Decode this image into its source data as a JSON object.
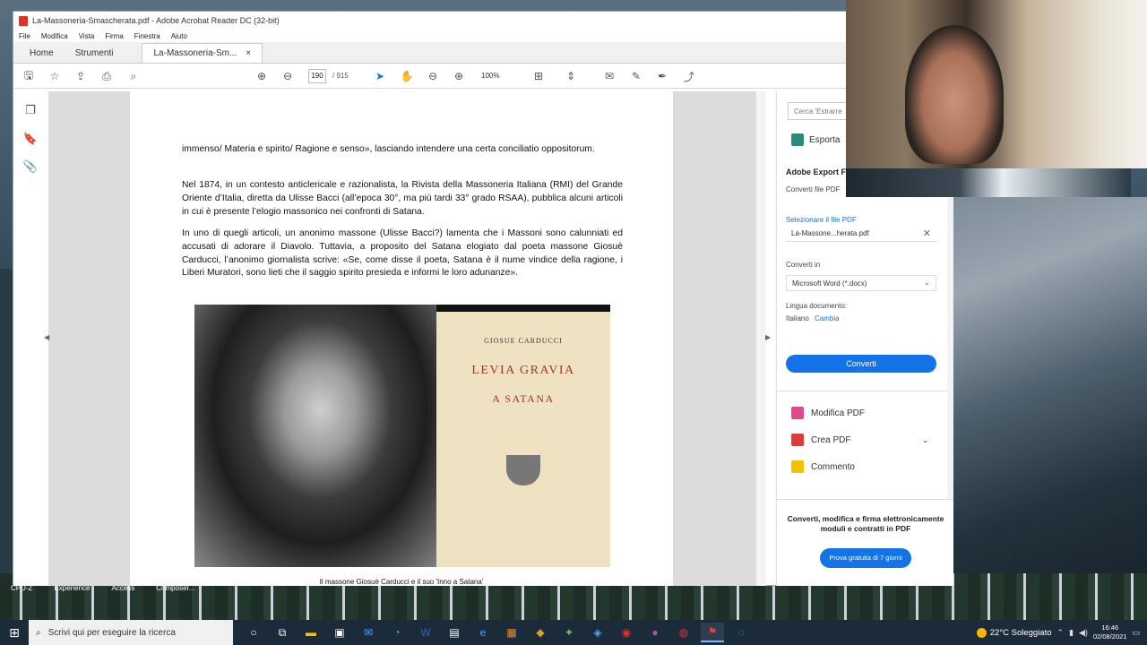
{
  "window": {
    "title": "La-Massoneria-Smascherata.pdf - Adobe Acrobat Reader DC (32-bit)",
    "menu": [
      "File",
      "Modifica",
      "Vista",
      "Firma",
      "Finestra",
      "Aiuto"
    ]
  },
  "tabs": {
    "home": "Home",
    "tools": "Strumenti",
    "document": "La-Massoneria-Sm...",
    "close": "×"
  },
  "toolbar": {
    "current_page": "190",
    "total_pages": "/ 915",
    "zoom": "100%"
  },
  "document": {
    "paragraphs": [
      "immenso/ Materia e spirito/ Ragione e senso», lasciando intendere una certa conciliatio oppositorum.",
      "Nel 1874, in un contesto anticlericale e razionalista, la Rivista della Massoneria Italiana (RMI) del Grande Oriente d’Italia, diretta da Ulisse Bacci (all’epoca 30°, ma più tardi 33° grado RSAA), pubblica alcuni articoli in cui è presente l’elogio massonico nei confronti di Satana.",
      "In uno di quegli articoli, un anonimo massone (Ulisse Bacci?) lamenta che i Massoni sono calunniati ed accusati di adorare il Diavolo. Tuttavia, a proposito del Satana elogiato dal poeta massone Giosuè Carducci, l’anonimo giornalista scrive: «Se, come disse il poeta, Satana è il nume vindice della ragione, i Liberi Muratori, sono lieti che il saggio spirito presieda e informi le loro adunanze»."
    ],
    "cover": {
      "author": "GIOSUE CARDUCCI",
      "title": "LEVIA GRAVIA",
      "subtitle": "A SATANA"
    },
    "caption": "Il massone Giosuè Carducci e il suo 'Inno a Satana'"
  },
  "right_panel": {
    "search_placeholder": "Cerca 'Estrarre",
    "export_label": "Esporta",
    "heading": "Adobe Export F",
    "convert_file_label": "Converti file PDF",
    "select_pdf_link": "Selezionare il file PDF",
    "file_name": "La-Massone...herata.pdf",
    "convert_to_label": "Converti in",
    "format_selected": "Microsoft Word (*.docx)",
    "language_label": "Lingua documento:",
    "language_value": "Italiano",
    "language_change": "Cambia",
    "convert_button": "Converti",
    "tools": [
      "Modifica PDF",
      "Crea PDF",
      "Commento"
    ],
    "promo_text": "Converti, modifica e firma elettronicamente moduli e contratti in PDF",
    "promo_button": "Prova gratuita di 7 giorni"
  },
  "desktop_labels": [
    "CPU-Z",
    "Experience",
    "Access",
    "Composer..."
  ],
  "taskbar": {
    "search_placeholder": "Scrivi qui per eseguire la ricerca",
    "weather": "22°C Soleggiato",
    "time": "16:46",
    "date": "02/08/2021"
  },
  "colors": {
    "accent": "#1473e6",
    "taskbar": "#1c2b3a"
  }
}
